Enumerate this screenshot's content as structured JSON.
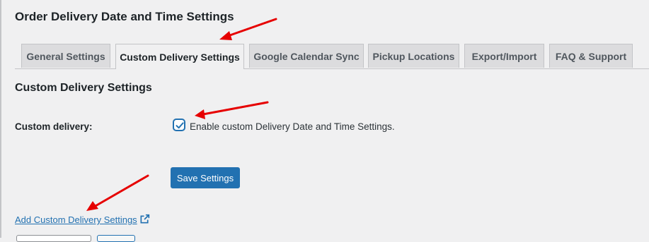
{
  "page": {
    "title": "Order Delivery Date and Time Settings"
  },
  "tabs": [
    {
      "label": "General Settings",
      "active": false
    },
    {
      "label": "Custom Delivery Settings",
      "active": true
    },
    {
      "label": "Google Calendar Sync",
      "active": false
    },
    {
      "label": "Pickup Locations",
      "active": false
    },
    {
      "label": "Export/Import",
      "active": false
    },
    {
      "label": "FAQ & Support",
      "active": false
    }
  ],
  "section": {
    "title": "Custom Delivery Settings",
    "custom_delivery": {
      "label": "Custom delivery:",
      "checkbox_label": "Enable custom Delivery Date and Time Settings.",
      "checked": true
    }
  },
  "buttons": {
    "save_label": "Save Settings"
  },
  "links": {
    "add_custom_delivery_settings": "Add Custom Delivery Settings"
  },
  "icons": {
    "checkbox_check": "check-icon",
    "external_link": "external-link-icon",
    "annotation": "red-arrow-icon"
  },
  "colors": {
    "accent": "#2271b1",
    "annotation_arrow": "#e60000",
    "background": "#f0f0f1",
    "tab_inactive": "#dcdcde"
  }
}
